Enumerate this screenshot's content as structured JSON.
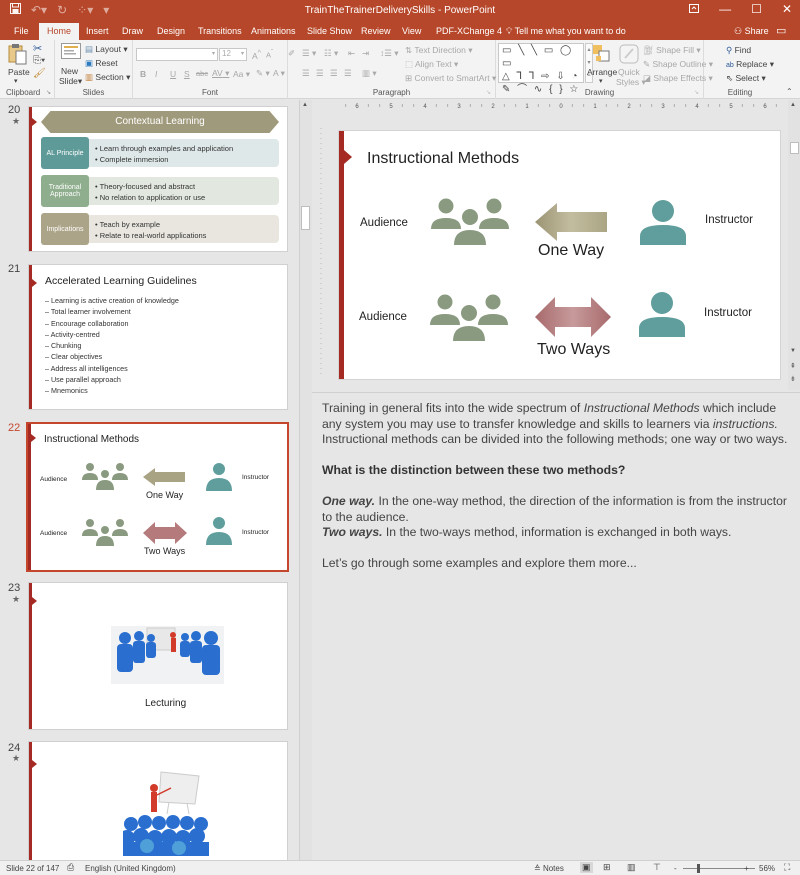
{
  "window": {
    "title": "TrainTheTrainerDeliverySkills  -  PowerPoint",
    "qat": {
      "save": "save-icon",
      "undo": "undo-icon",
      "redo": "redo-icon",
      "start": "start-from-beginning-icon",
      "customize": "customize-qat-icon"
    },
    "controls": {
      "ribbon_display": "ribbon-display-options-icon",
      "minimize": "—",
      "maximize": "☐",
      "close": "✕"
    }
  },
  "tabs": [
    {
      "label": "File"
    },
    {
      "label": "Home",
      "active": true
    },
    {
      "label": "Insert"
    },
    {
      "label": "Draw"
    },
    {
      "label": "Design"
    },
    {
      "label": "Transitions"
    },
    {
      "label": "Animations"
    },
    {
      "label": "Slide Show"
    },
    {
      "label": "Review"
    },
    {
      "label": "View"
    },
    {
      "label": "PDF-XChange 4"
    }
  ],
  "tell_me": "Tell me what you want to do",
  "share": "Share",
  "ribbon": {
    "clipboard": {
      "label": "Clipboard",
      "paste": "Paste"
    },
    "slides": {
      "label": "Slides",
      "new_slide": "New",
      "new_slide2": "Slide",
      "layout": "Layout",
      "reset": "Reset",
      "section": "Section"
    },
    "font": {
      "label": "Font",
      "font_name": "",
      "font_size": "12",
      "bold": "B",
      "italic": "I",
      "underline": "U",
      "shadow": "S",
      "strike": "abc",
      "spacing": "AV",
      "case": "Aa",
      "grow": "A",
      "shrink": "A"
    },
    "paragraph": {
      "label": "Paragraph",
      "text_direction": "Text Direction",
      "align_text": "Align Text",
      "smartart": "Convert to SmartArt"
    },
    "drawing": {
      "label": "Drawing",
      "arrange": "Arrange",
      "quick_styles": "Quick",
      "quick_styles2": "Styles",
      "shape_fill": "Shape Fill",
      "shape_outline": "Shape Outline",
      "shape_effects": "Shape Effects",
      "gallery_row1": "▭ ╲ ╲ ▭ ◯ ▭",
      "gallery_row2": "△ ⅂ ⅂ ⇨ ⇩ ◔",
      "gallery_row3": "✎ ⌒ ∿ { } ☆"
    },
    "editing": {
      "label": "Editing",
      "find": "Find",
      "replace": "Replace",
      "select": "Select"
    }
  },
  "thumbnails": [
    {
      "number": "20",
      "star": "★",
      "banner": "Contextual Learning",
      "rows": [
        {
          "label": "AL Principle",
          "bullets": [
            "• Learn through examples and application",
            "• Complete immersion"
          ],
          "color": "#5e9a98",
          "bg": "#dfe8e8"
        },
        {
          "label": "Traditional Approach",
          "bullets": [
            "• Theory-focused and abstract",
            "• No relation to application or use"
          ],
          "color": "#8fae8d",
          "bg": "#e2e8df"
        },
        {
          "label": "Implications",
          "bullets": [
            "• Teach by example",
            "• Relate to real-world applications"
          ],
          "color": "#aca489",
          "bg": "#e8e6df"
        }
      ]
    },
    {
      "number": "21",
      "title": "Accelerated Learning Guidelines",
      "items": [
        "– Learning is active creation of knowledge",
        "– Total learner involvement",
        "– Encourage collaboration",
        "– Activity-centred",
        "– Chunking",
        "– Clear objectives",
        "– Address all intelligences",
        "– Use parallel approach",
        "– Mnemonics"
      ]
    },
    {
      "number": "22",
      "selected": true,
      "title": "Instructional Methods",
      "audience": "Audience",
      "instructor": "Instructor",
      "one_way": "One Way",
      "two_ways": "Two Ways"
    },
    {
      "number": "23",
      "star": "★",
      "caption": "Lecturing",
      "image": "lecture-audience-image"
    },
    {
      "number": "24",
      "star": "★",
      "image": "presenter-crowd-image"
    }
  ],
  "slide": {
    "title": "Instructional Methods",
    "row1": {
      "left": "Audience",
      "right": "Instructor",
      "caption": "One Way"
    },
    "row2": {
      "left": "Audience",
      "right": "Instructor",
      "caption": "Two Ways"
    },
    "colors": {
      "accent": "#a52a24",
      "group": "#8a9a80",
      "person": "#5f9e9c",
      "one_way_arrow": "#a8a383",
      "two_way_arrow": "#b47a7c"
    }
  },
  "ruler": {
    "h_ticks": [
      "6",
      "5",
      "4",
      "3",
      "2",
      "1",
      "0",
      "1",
      "2",
      "3",
      "4",
      "5",
      "6"
    ]
  },
  "notes": {
    "p1_a": "Training in general fits into the wide spectrum of ",
    "p1_em1": "Instructional Methods",
    "p1_b": " which include any system you may use to transfer knowledge and skills to learners via ",
    "p1_em2": "instructions.",
    "p1_c": " Instructional methods can be divided into the following methods; one way or two ways.",
    "question": "What is the distinction between these two methods?",
    "one_way_label": "One way.",
    "one_way_text": " In the one-way method, the direction of the information is from the instructor to the audience.",
    "two_ways_label": "Two ways.",
    "two_ways_text": " In the two-ways method, information is exchanged in both ways.",
    "closing": "Let’s go through some examples and explore them more..."
  },
  "status": {
    "slide_counter": "Slide 22 of 147",
    "language": "English (United Kingdom)",
    "notes": "Notes",
    "zoom_minus": "-",
    "zoom_plus": "+",
    "zoom": "56%"
  }
}
